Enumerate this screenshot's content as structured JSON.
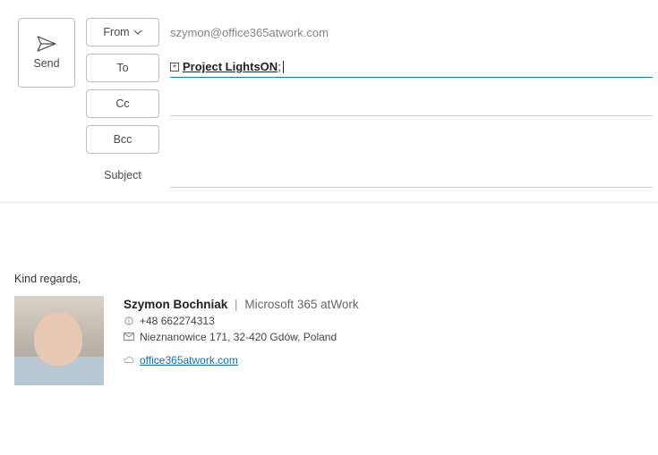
{
  "send": {
    "label": "Send"
  },
  "fields": {
    "from": {
      "button": "From",
      "value": "szymon@office365atwork.com"
    },
    "to": {
      "button": "To",
      "recipient": "Project LightsON"
    },
    "cc": {
      "button": "Cc"
    },
    "bcc": {
      "button": "Bcc"
    },
    "subject": {
      "label": "Subject",
      "value": ""
    }
  },
  "body": {
    "closing": "Kind regards,"
  },
  "signature": {
    "name": "Szymon Bochniak",
    "separator": "|",
    "company": "Microsoft 365 atWork",
    "phone": "+48 662274313",
    "address": "Nieznanowice 171, 32-420 Gdów, Poland",
    "website": "office365atwork.com"
  }
}
